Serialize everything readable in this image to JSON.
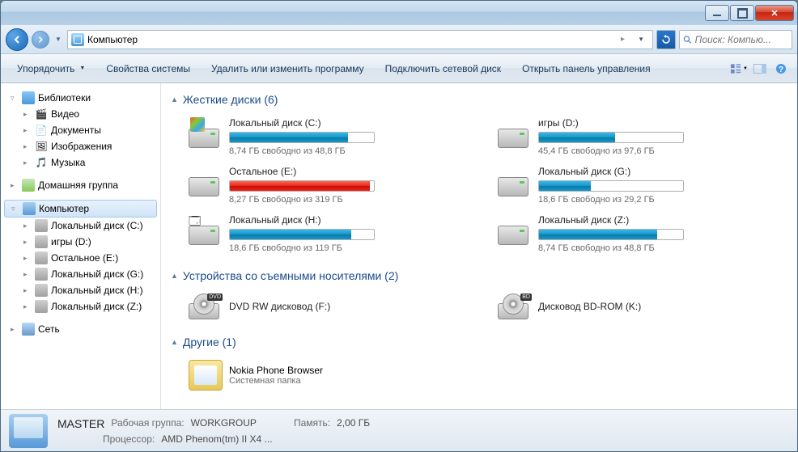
{
  "address": {
    "location": "Компьютер"
  },
  "search": {
    "placeholder": "Поиск: Компью..."
  },
  "toolbar": {
    "organize": "Упорядочить",
    "properties": "Свойства системы",
    "uninstall": "Удалить или изменить программу",
    "map_drive": "Подключить сетевой диск",
    "control_panel": "Открыть панель управления"
  },
  "sidebar": {
    "libraries": "Библиотеки",
    "lib_items": {
      "video": "Видео",
      "documents": "Документы",
      "pictures": "Изображения",
      "music": "Музыка"
    },
    "homegroup": "Домашняя группа",
    "computer": "Компьютер",
    "drives": {
      "c": "Локальный диск (C:)",
      "d": "игры (D:)",
      "e": "Остальное (E:)",
      "g": "Локальный диск (G:)",
      "h": "Локальный диск (H:)",
      "z": "Локальный диск (Z:)"
    },
    "network": "Сеть"
  },
  "sections": {
    "hdd": "Жесткие диски (6)",
    "removable": "Устройства со съемными носителями (2)",
    "other": "Другие (1)"
  },
  "drives": {
    "c": {
      "name": "Локальный диск (C:)",
      "status": "8,74 ГБ свободно из 48,8 ГБ",
      "pct": 82
    },
    "d": {
      "name": "игры (D:)",
      "status": "45,4 ГБ свободно из 97,6 ГБ",
      "pct": 53
    },
    "e": {
      "name": "Остальное (E:)",
      "status": "8,27 ГБ свободно из 319 ГБ",
      "pct": 97
    },
    "g": {
      "name": "Локальный диск (G:)",
      "status": "18,6 ГБ свободно из 29,2 ГБ",
      "pct": 36
    },
    "h": {
      "name": "Локальный диск (H:)",
      "status": "18,6 ГБ свободно из 119 ГБ",
      "pct": 84
    },
    "z": {
      "name": "Локальный диск (Z:)",
      "status": "8,74 ГБ свободно из 48,8 ГБ",
      "pct": 82
    }
  },
  "devices": {
    "dvd": {
      "name": "DVD RW дисковод (F:)",
      "badge": "DVD"
    },
    "bd": {
      "name": "Дисковод BD-ROM (K:)",
      "badge": "BD"
    }
  },
  "other": {
    "nokia": {
      "name": "Nokia Phone Browser",
      "sub": "Системная папка"
    }
  },
  "status": {
    "name": "MASTER",
    "workgroup_label": "Рабочая группа:",
    "workgroup": "WORKGROUP",
    "memory_label": "Память:",
    "memory": "2,00 ГБ",
    "processor_label": "Процессор:",
    "processor": "AMD Phenom(tm) II X4 ..."
  }
}
